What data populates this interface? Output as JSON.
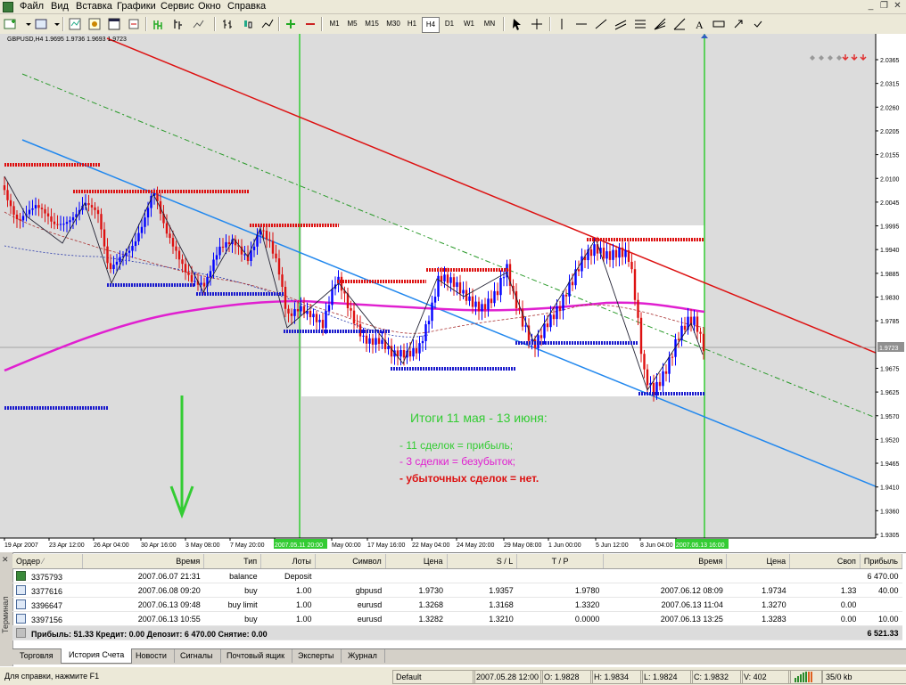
{
  "menu": {
    "items": [
      "Файл",
      "Вид",
      "Вставка",
      "Графики",
      "Сервис",
      "Окно",
      "Справка"
    ]
  },
  "toolbar": {
    "timeframes": [
      "M1",
      "M5",
      "M15",
      "M30",
      "H1",
      "H4",
      "D1",
      "W1",
      "MN"
    ],
    "active_timeframe": "H4"
  },
  "chart": {
    "header": "GBPUSD,H4  1.9695 1.9736 1.9693 1.9723",
    "price_labels": [
      "2.0365",
      "2.0315",
      "2.0260",
      "2.0205",
      "2.0155",
      "2.0100",
      "2.0045",
      "1.9995",
      "1.9940",
      "1.9885",
      "1.9830",
      "1.9785",
      "1.9723",
      "1.9675",
      "1.9625",
      "1.9570",
      "1.9520",
      "1.9465",
      "1.9410",
      "1.9360",
      "1.9305"
    ],
    "current_price": "1.9723",
    "time_labels": [
      "19 Apr 2007",
      "23 Apr 12:00",
      "26 Apr 04:00",
      "30 Apr 16:00",
      "3 May 08:00",
      "7 May 20:00",
      "2007.05.11 20:00",
      "May 00:00",
      "17 May 16:00",
      "22 May 04:00",
      "24 May 20:00",
      "29 May 08:00",
      "1 Jun 00:00",
      "5 Jun 12:00",
      "8 Jun 04:00",
      "2007.06.13 16:00"
    ],
    "marked_time_start": "2007.05.11 20:00",
    "marked_time_end": "2007.06.13 16:00",
    "annotation": {
      "title": "Итоги 11 мая - 13 июня:",
      "line1": "- 11 сделок = прибыль;",
      "line2": "- 3 сделки = безубыток;",
      "line3": "- убыточных сделок = нет."
    },
    "colors": {
      "green": "#33cc33",
      "red": "#dd1111",
      "blue": "#1a1acc",
      "magenta": "#e020d0",
      "channel_blue": "#2288ee"
    }
  },
  "history": {
    "columns": [
      "Ордер",
      "Время",
      "Тип",
      "Лоты",
      "Символ",
      "Цена",
      "S / L",
      "T / P",
      "Время",
      "Цена",
      "Своп",
      "Прибыль"
    ],
    "rows": [
      {
        "order": "3375793",
        "time": "2007.06.07 21:31",
        "type": "balance",
        "lots": "Deposit",
        "symbol": "",
        "price": "",
        "sl": "",
        "tp": "",
        "close_time": "",
        "close_price": "",
        "swap": "",
        "profit": "6 470.00"
      },
      {
        "order": "3377616",
        "time": "2007.06.08 09:20",
        "type": "buy",
        "lots": "1.00",
        "symbol": "gbpusd",
        "price": "1.9730",
        "sl": "1.9357",
        "tp": "1.9780",
        "close_time": "2007.06.12 08:09",
        "close_price": "1.9734",
        "swap": "1.33",
        "profit": "40.00"
      },
      {
        "order": "3396647",
        "time": "2007.06.13 09:48",
        "type": "buy limit",
        "lots": "1.00",
        "symbol": "eurusd",
        "price": "1.3268",
        "sl": "1.3168",
        "tp": "1.3320",
        "close_time": "2007.06.13 11:04",
        "close_price": "1.3270",
        "swap": "0.00",
        "profit": ""
      },
      {
        "order": "3397156",
        "time": "2007.06.13 10:55",
        "type": "buy",
        "lots": "1.00",
        "symbol": "eurusd",
        "price": "1.3282",
        "sl": "1.3210",
        "tp": "0.0000",
        "close_time": "2007.06.13 13:25",
        "close_price": "1.3283",
        "swap": "0.00",
        "profit": "10.00"
      }
    ],
    "summary": "Прибыль: 51.33  Кредит: 0.00  Депозит: 6 470.00  Снятие: 0.00",
    "summary_total": "6 521.33"
  },
  "side_label": "Терминал",
  "tabs": [
    "Торговля",
    "История Счета",
    "Новости",
    "Сигналы",
    "Почтовый ящик",
    "Эксперты",
    "Журнал"
  ],
  "active_tab": "История Счета",
  "status": {
    "help": "Для справки, нажмите F1",
    "profile": "Default",
    "datetime": "2007.05.28 12:00",
    "open": "O: 1.9828",
    "high": "H: 1.9834",
    "low": "L: 1.9824",
    "close": "C: 1.9832",
    "volume": "V: 402",
    "traffic": "35/0 kb"
  }
}
